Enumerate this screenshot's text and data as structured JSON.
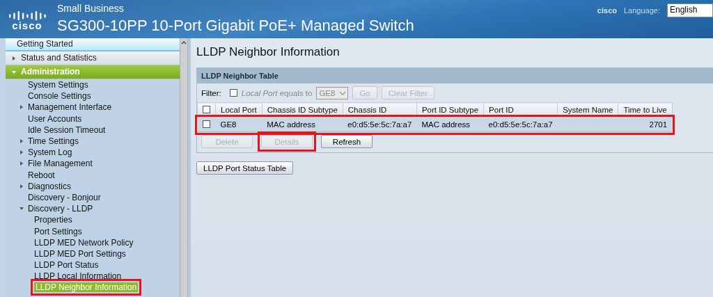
{
  "header": {
    "logo_text": "cisco",
    "subtitle": "Small Business",
    "title": "SG300-10PP 10-Port Gigabit PoE+ Managed Switch",
    "user_link": "cisco",
    "language_label": "Language:",
    "language": "English"
  },
  "sidebar": {
    "items": [
      {
        "label": "Getting Started",
        "selected": false,
        "kind": "start"
      },
      {
        "label": "Status and Statistics",
        "selected": false,
        "kind": "section",
        "expanded": false
      },
      {
        "label": "Administration",
        "selected": false,
        "kind": "section",
        "expanded": true,
        "children": [
          {
            "label": "System Settings",
            "selected": false
          },
          {
            "label": "Console Settings",
            "selected": false
          },
          {
            "label": "Management Interface",
            "selected": false,
            "expanded": false
          },
          {
            "label": "User Accounts",
            "selected": false
          },
          {
            "label": "Idle Session Timeout",
            "selected": false
          },
          {
            "label": "Time Settings",
            "selected": false,
            "expanded": false
          },
          {
            "label": "System Log",
            "selected": false,
            "expanded": false
          },
          {
            "label": "File Management",
            "selected": false,
            "expanded": false
          },
          {
            "label": "Reboot",
            "selected": false
          },
          {
            "label": "Diagnostics",
            "selected": false,
            "expanded": false
          },
          {
            "label": "Discovery - Bonjour",
            "selected": false
          },
          {
            "label": "Discovery - LLDP",
            "selected": false,
            "expanded": true,
            "children": [
              {
                "label": "Properties",
                "selected": false
              },
              {
                "label": "Port Settings",
                "selected": false
              },
              {
                "label": "LLDP MED Network Policy",
                "selected": false
              },
              {
                "label": "LLDP MED Port Settings",
                "selected": false
              },
              {
                "label": "LLDP Port Status",
                "selected": false
              },
              {
                "label": "LLDP Local Information",
                "selected": false
              },
              {
                "label": "LLDP Neighbor Information",
                "selected": true,
                "highlighted": true
              }
            ]
          }
        ]
      }
    ]
  },
  "page": {
    "title": "LLDP Neighbor Information",
    "table": {
      "title": "LLDP Neighbor Table",
      "filter": {
        "label": "Filter:",
        "checked": false,
        "text": "*Local Port* equals to",
        "port": "GE8",
        "port_disabled": true,
        "buttons": [
          {
            "label": "Go",
            "disabled": true
          },
          {
            "label": "Clear Filter",
            "disabled": true
          }
        ]
      },
      "select_all_checked": false,
      "columns": [
        "Local Port",
        "Chassis ID Subtype",
        "Chassis ID",
        "Port ID Subtype",
        "Port ID",
        "System Name",
        "Time to Live"
      ],
      "rows": [
        {
          "checked": false,
          "highlighted": true,
          "cells": [
            "GE8",
            "MAC address",
            "e0:d5:5e:5c:7a:a7",
            "MAC address",
            "e0:d5:5e:5c:7a:a7",
            "",
            "2701"
          ]
        }
      ],
      "buttons": [
        {
          "label": "Delete",
          "disabled": true,
          "highlighted": false
        },
        {
          "label": "Details",
          "disabled": true,
          "highlighted": true
        },
        {
          "label": "Refresh",
          "disabled": false,
          "highlighted": false
        }
      ]
    },
    "buttons": [
      {
        "label": "LLDP Port Status Table",
        "disabled": false
      }
    ]
  }
}
